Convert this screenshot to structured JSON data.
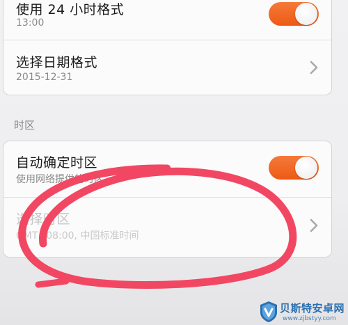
{
  "colors": {
    "accent": "#ee5a14",
    "annotation": "#f24763",
    "watermark": "#2b6fb0"
  },
  "time_settings": {
    "use_24h": {
      "label": "使用 24 小时格式",
      "value": "13:00",
      "toggle_on": true
    },
    "date_format": {
      "label": "选择日期格式",
      "value": "2015-12-31",
      "icon": "chevron-right-icon"
    }
  },
  "timezone_section": {
    "header": "时区",
    "auto_timezone": {
      "label": "自动确定时区",
      "description": "使用网络提供的时区",
      "toggle_on": true
    },
    "select_timezone": {
      "label": "选择时区",
      "value": "GMT+08:00, 中国标准时间",
      "disabled": true,
      "icon": "chevron-right-icon"
    }
  },
  "watermark": {
    "name": "贝斯特安卓网",
    "url": "www.zjbstyy.com"
  }
}
